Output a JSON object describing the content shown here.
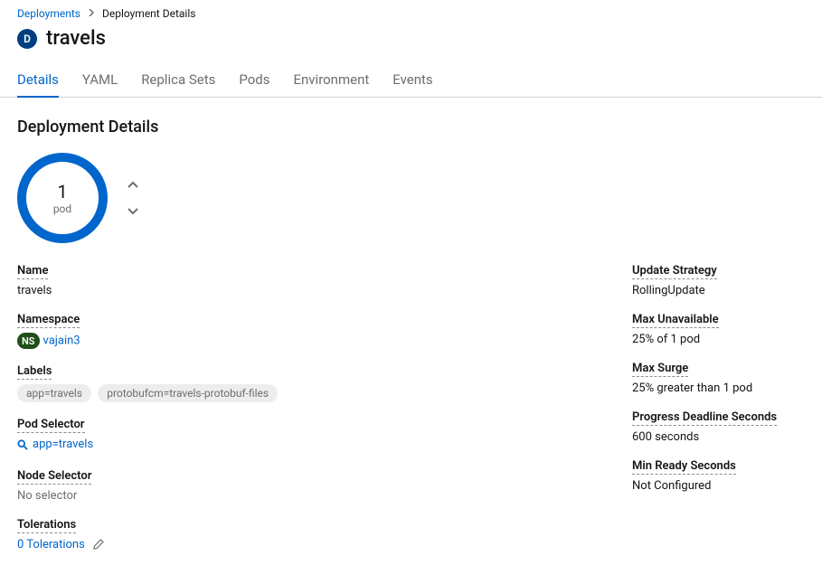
{
  "breadcrumb": {
    "parent": "Deployments",
    "current": "Deployment Details"
  },
  "resource": {
    "badge": "D",
    "title": "travels"
  },
  "tabs": [
    "Details",
    "YAML",
    "Replica Sets",
    "Pods",
    "Environment",
    "Events"
  ],
  "section_title": "Deployment Details",
  "podRing": {
    "count": "1",
    "label": "pod"
  },
  "left": {
    "name": {
      "label": "Name",
      "value": "travels"
    },
    "namespace": {
      "label": "Namespace",
      "badge": "NS",
      "value": "vajain3"
    },
    "labels": {
      "label": "Labels",
      "items": [
        "app=travels",
        "protobufcm=travels-protobuf-files"
      ]
    },
    "podSelector": {
      "label": "Pod Selector",
      "value": "app=travels"
    },
    "nodeSelector": {
      "label": "Node Selector",
      "value": "No selector"
    },
    "tolerations": {
      "label": "Tolerations",
      "value": "0 Tolerations"
    }
  },
  "right": {
    "updateStrategy": {
      "label": "Update Strategy",
      "value": "RollingUpdate"
    },
    "maxUnavailable": {
      "label": "Max Unavailable",
      "value": "25% of 1 pod"
    },
    "maxSurge": {
      "label": "Max Surge",
      "value": "25% greater than 1 pod"
    },
    "progressDeadline": {
      "label": "Progress Deadline Seconds",
      "value": "600 seconds"
    },
    "minReady": {
      "label": "Min Ready Seconds",
      "value": "Not Configured"
    }
  }
}
